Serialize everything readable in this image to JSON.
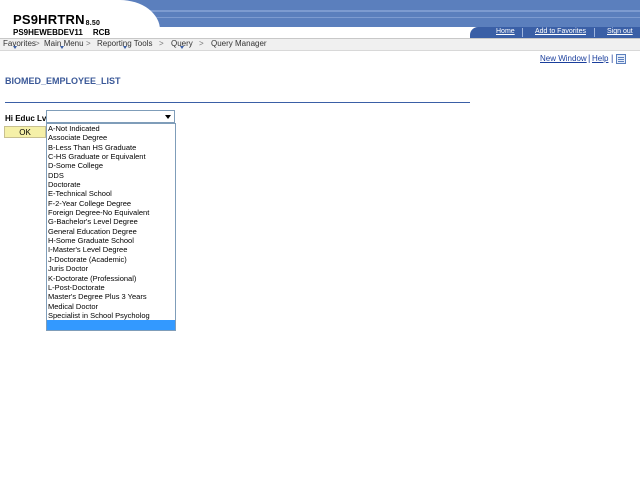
{
  "header": {
    "app_title": "PS9HRTRN",
    "version": "8.50",
    "database": "PS9HEWEBDEV11",
    "user": "RCB",
    "links": [
      "Home",
      "Add to Favorites",
      "Sign out"
    ]
  },
  "menubar": {
    "items": [
      "Favorites",
      "Main Menu",
      "Reporting Tools",
      "Query",
      "Query Manager"
    ],
    "separator": ">"
  },
  "toplinks": {
    "new_window": "New Window",
    "help": "Help",
    "separator": "|",
    "customize_icon": "customize-page-icon"
  },
  "page": {
    "title": "BIOMED_EMPLOYEE_LIST",
    "field_label": "Hi Educ Lv:",
    "field_value": "",
    "ok_label": "OK"
  },
  "dropdown": {
    "options": [
      "A-Not Indicated",
      "Associate Degree",
      "B-Less Than HS Graduate",
      "C-HS Graduate or Equivalent",
      "D-Some College",
      "DDS",
      "Doctorate",
      "E-Technical School",
      "F-2-Year College Degree",
      "Foreign Degree-No Equivalent",
      "G-Bachelor's Level Degree",
      "General Education Degree",
      "H-Some Graduate School",
      "I-Master's Level Degree",
      "J-Doctorate (Academic)",
      "Juris Doctor",
      "K-Doctorate (Professional)",
      "L-Post-Doctorate",
      "Master's Degree Plus 3 Years",
      "Medical Doctor",
      "Specialist in School Psycholog",
      ""
    ],
    "selected_index": 21
  },
  "colors": {
    "header_band": "#5b7fbd",
    "links_bar": "#3a5fa6",
    "title_text": "#3b5998",
    "ok_button": "#f5f0a8",
    "selection": "#3399ff"
  }
}
